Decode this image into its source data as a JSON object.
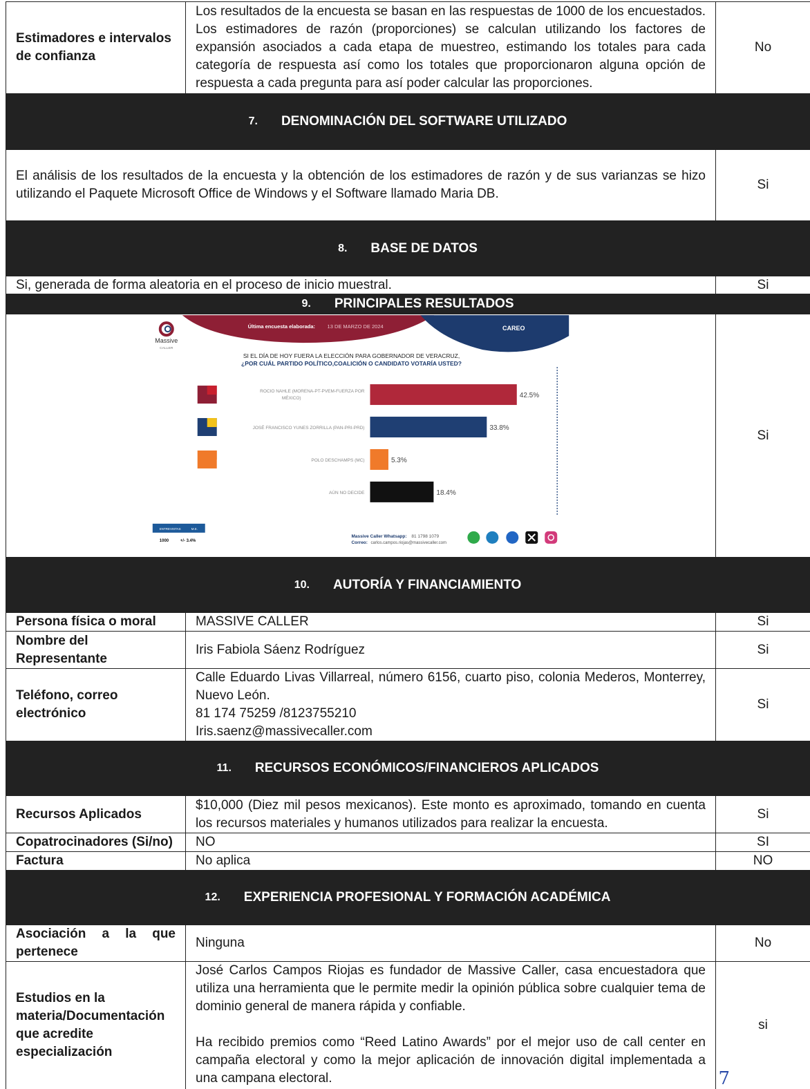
{
  "estimadores": {
    "label": "Estimadores e intervalos de confianza",
    "text": "Los resultados de la encuesta se basan en las respuestas de 1000 de los encuestados. Los estimadores de razón (proporciones) se calculan utilizando los factores de expansión asociados a cada etapa de muestreo, estimando los totales para cada categoría de respuesta así como los totales que proporcionaron alguna opción de respuesta a cada pregunta para así poder calcular las proporciones.",
    "value": "No"
  },
  "section7": {
    "num": "7.",
    "title": "DENOMINACIÓN DEL SOFTWARE UTILIZADO"
  },
  "software": {
    "text": "El análisis de los resultados de la encuesta y la obtención de los estimadores de razón y de sus varianzas se hizo utilizando el Paquete Microsoft Office de Windows y el Software llamado Maria DB.",
    "value": "Si"
  },
  "section8": {
    "num": "8.",
    "title": "BASE DE DATOS"
  },
  "base": {
    "text": "Si, generada de forma aleatoria en el proceso de inicio muestral.",
    "value": "Si"
  },
  "section9": {
    "num": "9.",
    "title": "PRINCIPALES RESULTADOS"
  },
  "results_value": "Si",
  "chart_header": {
    "brand": "Massive",
    "brand_sub": "CALLER",
    "last_survey_label": "Última encuesta elaborada:",
    "last_survey_date": "13 DE MARZO DE 2024",
    "careo": "CAREO",
    "question_line1": "SI EL DÍA DE HOY FUERA LA ELECCIÓN PARA GOBERNADOR DE VERACRUZ,",
    "question_line2": "¿POR CUÁL PARTIDO POLÍTICO,COALICIÓN O CANDIDATO VOTARÍA USTED?",
    "table_head1": "ENTREVISTAS",
    "table_head2": "M.E.",
    "table_val1": "1000",
    "table_val2": "+/- 3.4%",
    "contact_label1": "Massive Caller Whatsapp:",
    "contact_val1": "81 1798 1079",
    "contact_label2": "Correo:",
    "contact_val2": "carlos.campos.riojas@massivecaller.com"
  },
  "chart_data": {
    "type": "bar",
    "orientation": "horizontal",
    "categories": [
      "ROCIO NAHLE (MORENA-PT-PVEM-FUERZA POR MÉXICO)",
      "JOSÉ FRANCISCO YUNES ZORRILLA (PAN-PRI-PRD)",
      "POLO DESCHAMPS (MC)",
      "AÚN NO DECIDE"
    ],
    "values": [
      42.5,
      33.8,
      5.3,
      18.4
    ],
    "labels": [
      "42.5%",
      "33.8%",
      "5.3%",
      "18.4%"
    ],
    "colors": [
      "#b0283a",
      "#1f3f73",
      "#f07a2a",
      "#111111"
    ],
    "xlim": [
      0,
      60
    ]
  },
  "section10": {
    "num": "10.",
    "title": "AUTORÍA Y FINANCIAMIENTO"
  },
  "persona": {
    "label": "Persona física o moral",
    "text": "MASSIVE CALLER",
    "value": "Si"
  },
  "representante": {
    "label": "Nombre del Representante",
    "text": "Iris Fabiola Sáenz Rodríguez",
    "value": "Si"
  },
  "telefono": {
    "label": "Teléfono, correo electrónico",
    "line1": "Calle Eduardo Livas Villarreal, número 6156, cuarto piso, colonia Mederos, Monterrey, Nuevo León.",
    "line2": "81 174 75259 /8123755210",
    "line3": "Iris.saenz@massivecaller.com",
    "value": "Si"
  },
  "section11": {
    "num": "11.",
    "title": "RECURSOS ECONÓMICOS/FINANCIEROS APLICADOS"
  },
  "recursos": {
    "label": "Recursos Aplicados",
    "text": "$10,000 (Diez mil pesos mexicanos). Este monto es aproximado, tomando en cuenta los recursos materiales y humanos utilizados para realizar la encuesta.",
    "value": "Si"
  },
  "copatrocinadores": {
    "label": "Copatrocinadores (Si/no)",
    "text": "NO",
    "value": "SI"
  },
  "factura": {
    "label": "Factura",
    "text": "No aplica",
    "value": "NO"
  },
  "section12": {
    "num": "12.",
    "title": "EXPERIENCIA PROFESIONAL Y FORMACIÓN ACADÉMICA"
  },
  "asociacion": {
    "label": "Asociación a la que pertenece",
    "text": "Ninguna",
    "value": "No"
  },
  "estudios": {
    "label": "Estudios en la materia/Documentación que acredite especialización",
    "para1": "José Carlos Campos Riojas es fundador de Massive Caller, casa encuestadora que utiliza una herramienta que le permite medir la opinión pública sobre cualquier tema de dominio general de manera rápida y confiable.",
    "para2": "Ha recibido premios como “Reed Latino Awards” por el mejor uso de call center en campaña electoral y como la mejor aplicación de innovación digital implementada a una campana electoral.",
    "value": "si"
  },
  "margin_mark": "7"
}
